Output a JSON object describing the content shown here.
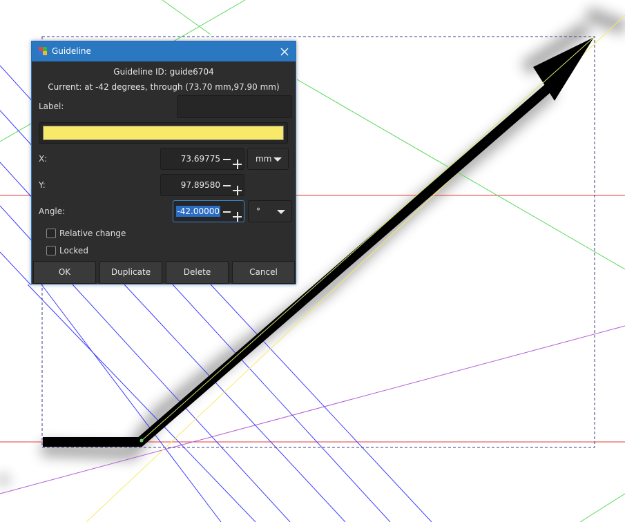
{
  "canvas": {
    "guide_color_horizontal": "#e63a3a",
    "guide_color_blue": "#3b3bff",
    "guide_color_green": "#59d859",
    "guide_color_purple": "#b25cd6",
    "arrow_color": "#000000"
  },
  "dialog": {
    "title": "Guideline",
    "close_icon": "close-icon",
    "guide_id": "Guideline ID: guide6704",
    "current": "Current: at -42 degrees, through (73.70 mm,97.90 mm)",
    "label_label": "Label:",
    "label_value": "",
    "guide_color": "#f9e969",
    "x_label": "X:",
    "x_value": "73.69775",
    "unit": "mm",
    "y_label": "Y:",
    "y_value": "97.89580",
    "angle_label": "Angle:",
    "angle_value": "-42.00000",
    "angle_unit": "°",
    "relative_change": "Relative change",
    "relative_checked": false,
    "locked": "Locked",
    "locked_checked": false,
    "buttons": {
      "ok": "OK",
      "duplicate": "Duplicate",
      "delete": "Delete",
      "cancel": "Cancel"
    }
  }
}
